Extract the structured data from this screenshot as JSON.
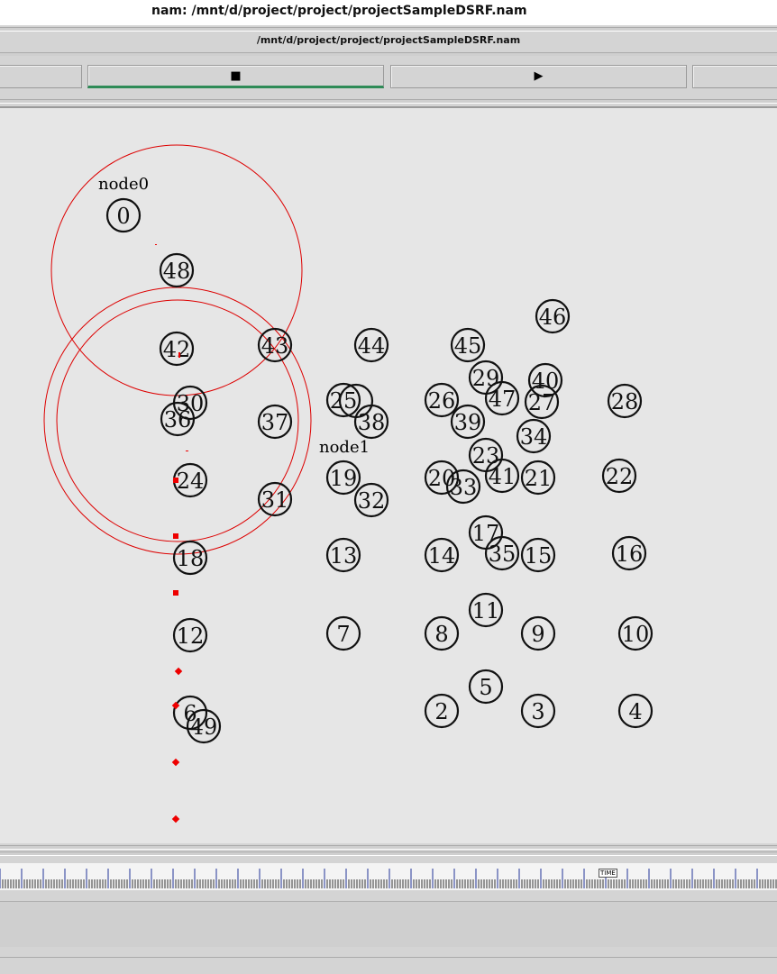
{
  "window": {
    "title": "nam: /mnt/d/project/project/projectSampleDSRF.nam"
  },
  "header": {
    "file_path": "/mnt/d/project/project/projectSampleDSRF.nam"
  },
  "toolbar": {
    "buttons": [
      {
        "name": "rewind-button",
        "glyph": ""
      },
      {
        "name": "stop-button",
        "glyph": "■"
      },
      {
        "name": "play-button",
        "glyph": "▶"
      },
      {
        "name": "fast-forward-button",
        "glyph": ""
      }
    ]
  },
  "canvas": {
    "annotations": [
      {
        "id": "node0-label",
        "text": "node0"
      },
      {
        "id": "node1-label",
        "text": "node1"
      }
    ],
    "nodes": [
      "0",
      "48",
      "46",
      "42",
      "43",
      "44",
      "45",
      "29",
      "40",
      "30",
      "36",
      "25",
      "26",
      "47",
      "27",
      "28",
      "37",
      "38",
      "39",
      "34",
      "23",
      "24",
      "19",
      "20",
      "41",
      "21",
      "22",
      "31",
      "33",
      "32",
      "13",
      "14",
      "17",
      "35",
      "15",
      "16",
      "18",
      "12",
      "7",
      "8",
      "11",
      "9",
      "10",
      "5",
      "6",
      "49",
      "2",
      "3",
      "4"
    ],
    "colors": {
      "node_stroke": "#111111",
      "range_circle": "#dd0000",
      "packet": "#ee0000"
    }
  },
  "timeline": {
    "label": "TIME"
  }
}
